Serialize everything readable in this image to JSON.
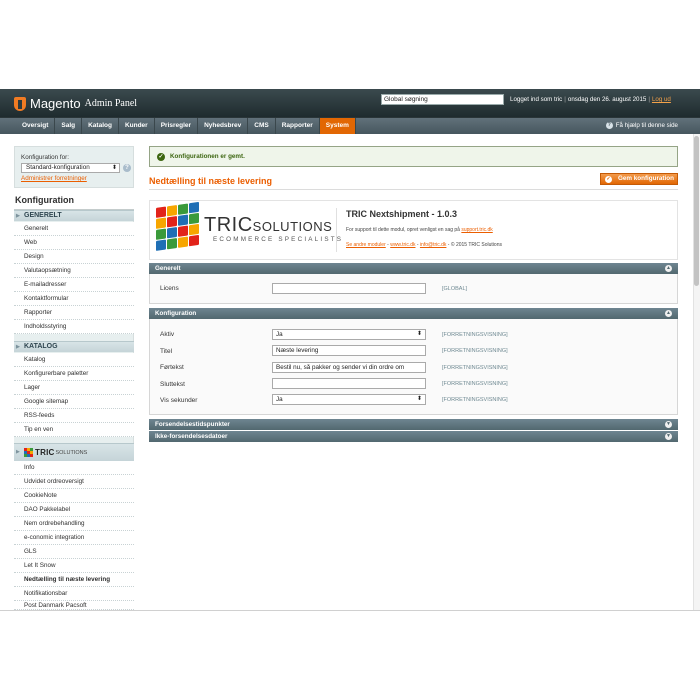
{
  "header": {
    "app_name": "Magento",
    "app_sub": "Admin Panel",
    "search_value": "Global søgning",
    "logged_in": "Logget ind som tric",
    "date": "onsdag den 26. august 2015",
    "logout": "Log ud",
    "help": "Få hjælp til denne side"
  },
  "nav": [
    {
      "label": "Oversigt"
    },
    {
      "label": "Salg"
    },
    {
      "label": "Katalog"
    },
    {
      "label": "Kunder"
    },
    {
      "label": "Prisregler"
    },
    {
      "label": "Nyhedsbrev"
    },
    {
      "label": "CMS"
    },
    {
      "label": "Rapporter"
    },
    {
      "label": "System"
    }
  ],
  "scope": {
    "label": "Konfiguration for:",
    "selected": "Standard-konfiguration",
    "manage_link": "Administrer forretninger"
  },
  "sidebar": {
    "title": "Konfiguration",
    "generelt": {
      "heading": "GENERELT",
      "items": [
        "Generelt",
        "Web",
        "Design",
        "Valutaopsætning",
        "E-mailadresser",
        "Kontaktformular",
        "Rapporter",
        "Indholdsstyring"
      ]
    },
    "katalog": {
      "heading": "KATALOG",
      "items": [
        "Katalog",
        "Konfigurerbare paletter",
        "Lager",
        "Google sitemap",
        "RSS-feeds",
        "Tip en ven"
      ]
    },
    "tric": {
      "word": "TRIC",
      "sol": "SOLUTIONS",
      "items": [
        "Info",
        "Udvidet ordreoversigt",
        "CookieNote",
        "DAO Pakkelabel",
        "Nem ordrebehandling",
        "e-conomic integration",
        "GLS",
        "Let It Snow",
        "Nedtælling til næste levering",
        "Notifikationsbar",
        "Post Danmark Pacsoft"
      ]
    }
  },
  "main": {
    "success_message": "Konfigurationen er gemt.",
    "page_title": "Nedtælling til næste levering",
    "save_button": "Gem konfiguration",
    "banner": {
      "brand": "TRIC",
      "brand_sol": "SOLUTIONS",
      "brand_sub": "ECOMMERCE SPECIALISTS",
      "ext_title": "TRIC Nextshipment - 1.0.3",
      "support_text": "For support til dette modul, opret venligst en sag på",
      "support_link": "support.tric.dk",
      "link_modules": "Se andre moduler",
      "link_site": "www.tric.dk",
      "link_mail": "info@tric.dk",
      "copyright": "© 2015 TRIC Solutions"
    },
    "sections": {
      "generelt": {
        "title": "Generelt",
        "license_label": "Licens",
        "license_value": "",
        "license_scope": "[GLOBAL]"
      },
      "konfiguration": {
        "title": "Konfiguration",
        "rows": [
          {
            "label": "Aktiv",
            "value": "Ja",
            "scope": "[FORRETNINGSVISNING]"
          },
          {
            "label": "Titel",
            "value": "Næste levering",
            "scope": "[FORRETNINGSVISNING]"
          },
          {
            "label": "Førtekst",
            "value": "Bestil nu, så pakker og sender vi din ordre om",
            "scope": "[FORRETNINGSVISNING]"
          },
          {
            "label": "Sluttekst",
            "value": "",
            "scope": "[FORRETNINGSVISNING]"
          },
          {
            "label": "Vis sekunder",
            "value": "Ja",
            "scope": "[FORRETNINGSVISNING]"
          }
        ]
      },
      "forsendelsestidspunkter": {
        "title": "Forsendelsestidspunkter"
      },
      "ikke_forsendelsesdatoer": {
        "title": "Ikke-forsendelsesdatoer"
      }
    }
  },
  "colors": {
    "accent": "#eb5e00",
    "header_dark": "#1f2b2e",
    "sidebar_bg": "#e7efef",
    "fieldset_head": "#52686f",
    "success_green": "#3d6611"
  }
}
